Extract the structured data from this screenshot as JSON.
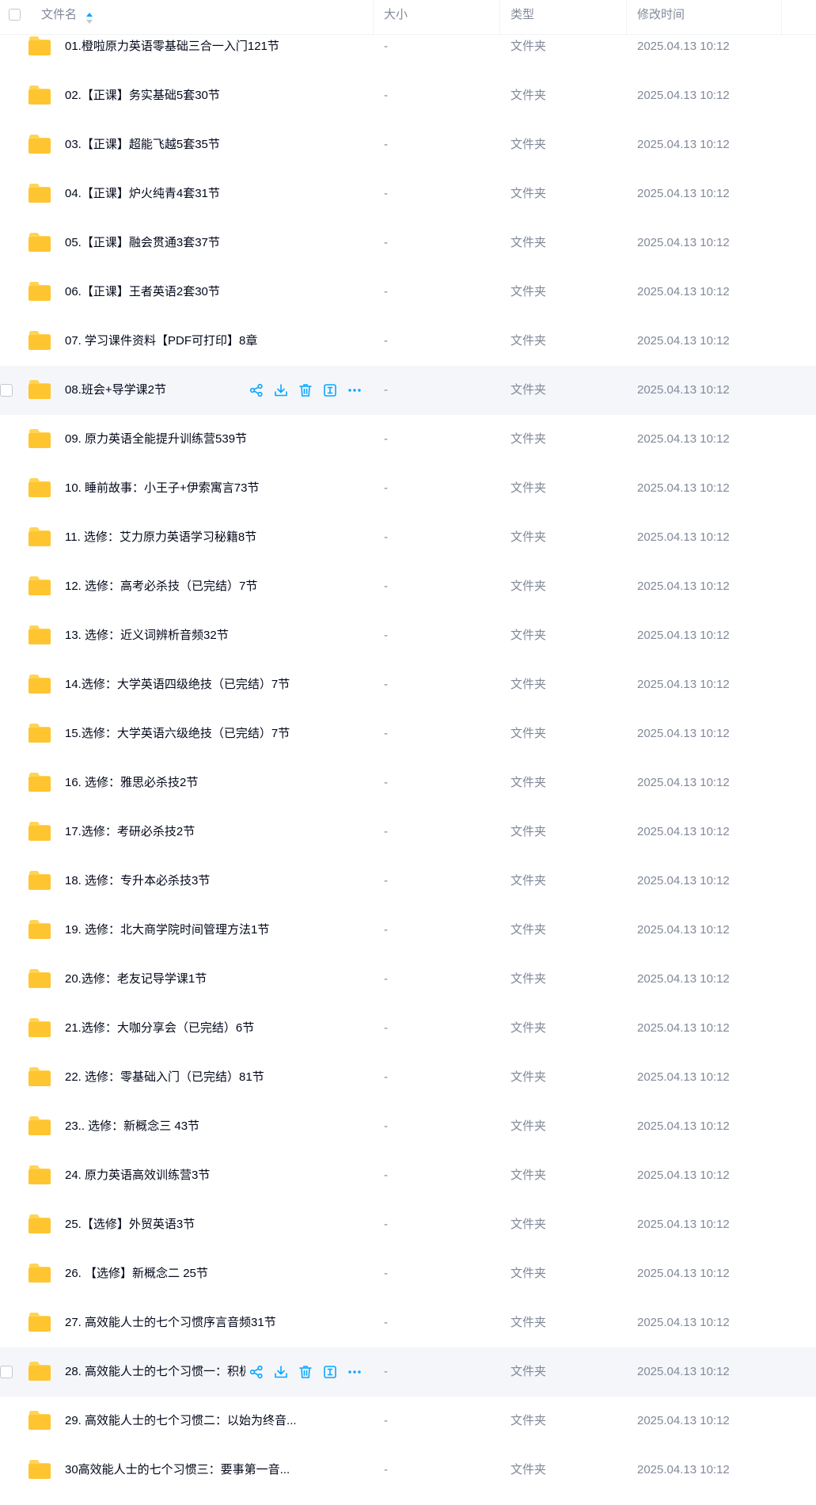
{
  "header": {
    "name": "文件名",
    "size": "大小",
    "type": "类型",
    "modified": "修改时间"
  },
  "colors": {
    "accent": "#06a7ff",
    "folder_yellow": "#ffc530",
    "folder_yellow_back": "#ffd453",
    "muted_text": "#818999",
    "row_hover_bg": "#f5f6fa"
  },
  "icons": {
    "sort": "sort-asc-icon",
    "folder": "folder-icon",
    "share": "share-icon",
    "download": "download-icon",
    "delete": "trash-icon",
    "rename": "rename-icon",
    "more": "more-icon"
  },
  "rows": [
    {
      "name": "01.橙啦原力英语零基础三合一入门121节",
      "size": "-",
      "type": "文件夹",
      "modified": "2025.04.13 10:12"
    },
    {
      "name": "02.【正课】务实基础5套30节",
      "size": "-",
      "type": "文件夹",
      "modified": "2025.04.13 10:12"
    },
    {
      "name": "03.【正课】超能飞越5套35节",
      "size": "-",
      "type": "文件夹",
      "modified": "2025.04.13 10:12"
    },
    {
      "name": "04.【正课】炉火纯青4套31节",
      "size": "-",
      "type": "文件夹",
      "modified": "2025.04.13 10:12"
    },
    {
      "name": "05.【正课】融会贯通3套37节",
      "size": "-",
      "type": "文件夹",
      "modified": "2025.04.13 10:12"
    },
    {
      "name": "06.【正课】王者英语2套30节",
      "size": "-",
      "type": "文件夹",
      "modified": "2025.04.13 10:12"
    },
    {
      "name": "07. 学习课件资料【PDF可打印】8章",
      "size": "-",
      "type": "文件夹",
      "modified": "2025.04.13 10:12"
    },
    {
      "name": "08.班会+导学课2节",
      "size": "-",
      "type": "文件夹",
      "modified": "2025.04.13 10:12",
      "hover": true
    },
    {
      "name": "09. 原力英语全能提升训练营539节",
      "size": "-",
      "type": "文件夹",
      "modified": "2025.04.13 10:12"
    },
    {
      "name": "10. 睡前故事：小王子+伊索寓言73节",
      "size": "-",
      "type": "文件夹",
      "modified": "2025.04.13 10:12"
    },
    {
      "name": "11. 选修：艾力原力英语学习秘籍8节",
      "size": "-",
      "type": "文件夹",
      "modified": "2025.04.13 10:12"
    },
    {
      "name": "12. 选修：高考必杀技（已完结）7节",
      "size": "-",
      "type": "文件夹",
      "modified": "2025.04.13 10:12"
    },
    {
      "name": "13. 选修：近义词辨析音频32节",
      "size": "-",
      "type": "文件夹",
      "modified": "2025.04.13 10:12"
    },
    {
      "name": "14.选修：大学英语四级绝技（已完结）7节",
      "size": "-",
      "type": "文件夹",
      "modified": "2025.04.13 10:12"
    },
    {
      "name": "15.选修：大学英语六级绝技（已完结）7节",
      "size": "-",
      "type": "文件夹",
      "modified": "2025.04.13 10:12"
    },
    {
      "name": "16. 选修：雅思必杀技2节",
      "size": "-",
      "type": "文件夹",
      "modified": "2025.04.13 10:12"
    },
    {
      "name": "17.选修：考研必杀技2节",
      "size": "-",
      "type": "文件夹",
      "modified": "2025.04.13 10:12"
    },
    {
      "name": "18. 选修：专升本必杀技3节",
      "size": "-",
      "type": "文件夹",
      "modified": "2025.04.13 10:12"
    },
    {
      "name": "19. 选修：北大商学院时间管理方法1节",
      "size": "-",
      "type": "文件夹",
      "modified": "2025.04.13 10:12"
    },
    {
      "name": "20.选修：老友记导学课1节",
      "size": "-",
      "type": "文件夹",
      "modified": "2025.04.13 10:12"
    },
    {
      "name": "21.选修：大咖分享会（已完结）6节",
      "size": "-",
      "type": "文件夹",
      "modified": "2025.04.13 10:12"
    },
    {
      "name": "22. 选修：零基础入门（已完结）81节",
      "size": "-",
      "type": "文件夹",
      "modified": "2025.04.13 10:12"
    },
    {
      "name": "23.. 选修：新概念三 43节",
      "size": "-",
      "type": "文件夹",
      "modified": "2025.04.13 10:12"
    },
    {
      "name": "24. 原力英语高效训练营3节",
      "size": "-",
      "type": "文件夹",
      "modified": "2025.04.13 10:12"
    },
    {
      "name": "25.【选修】外贸英语3节",
      "size": "-",
      "type": "文件夹",
      "modified": "2025.04.13 10:12"
    },
    {
      "name": "26. 【选修】新概念二 25节",
      "size": "-",
      "type": "文件夹",
      "modified": "2025.04.13 10:12"
    },
    {
      "name": "27. 高效能人士的七个习惯序言音频31节",
      "size": "-",
      "type": "文件夹",
      "modified": "2025.04.13 10:12"
    },
    {
      "name": "28. 高效能人士的七个习惯一：积极",
      "size": "-",
      "type": "文件夹",
      "modified": "2025.04.13 10:12",
      "hover": true
    },
    {
      "name": "29. 高效能人士的七个习惯二：以始为终音...",
      "size": "-",
      "type": "文件夹",
      "modified": "2025.04.13 10:12"
    },
    {
      "name": "30高效能人士的七个习惯三：要事第一音...",
      "size": "-",
      "type": "文件夹",
      "modified": "2025.04.13 10:12"
    }
  ]
}
